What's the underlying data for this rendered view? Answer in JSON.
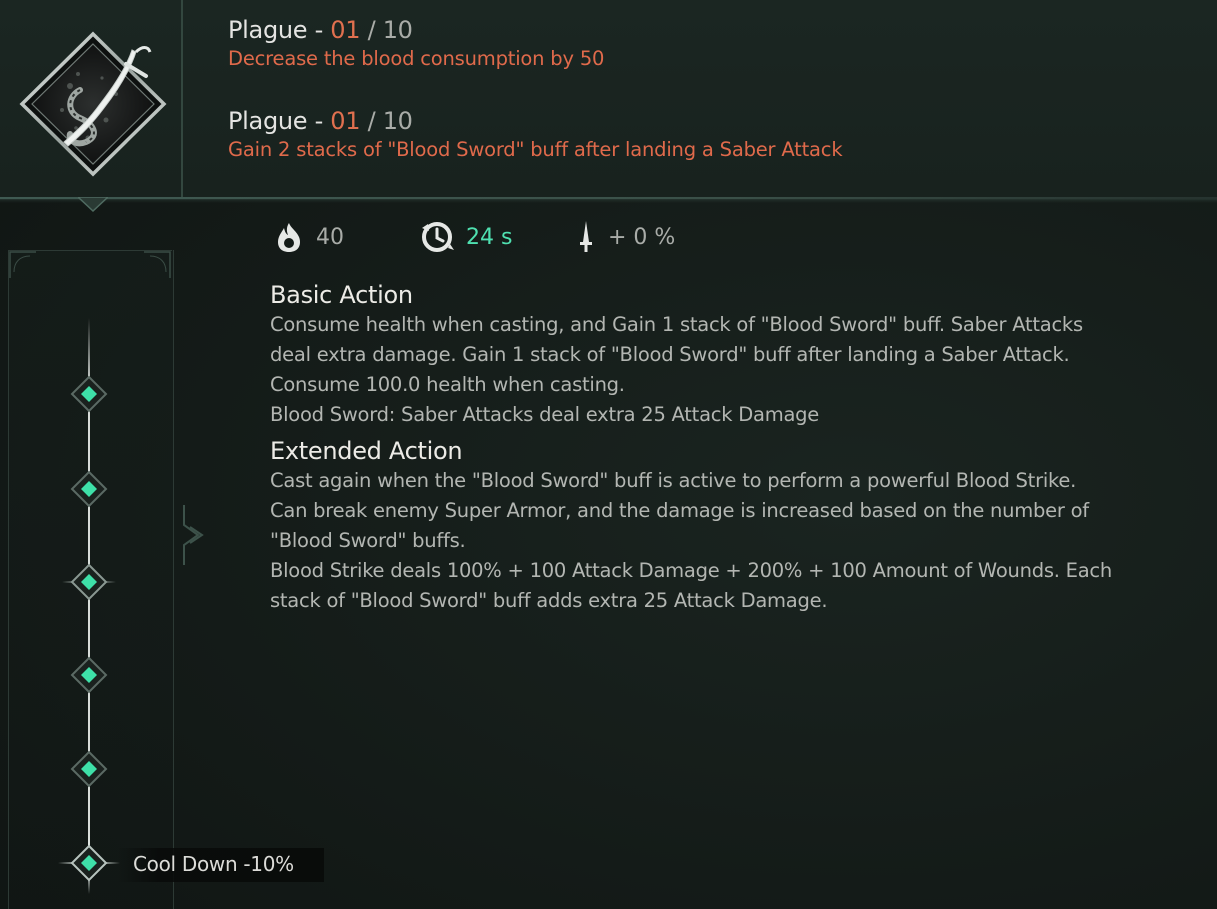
{
  "skill": {
    "icon": "saber-serpent-icon"
  },
  "plagues": [
    {
      "name": "Plague - ",
      "level": "01",
      "separator": " / ",
      "max": "10",
      "description": "Decrease the blood consumption by 50"
    },
    {
      "name": "Plague - ",
      "level": "01",
      "separator": " / ",
      "max": "10",
      "description": "Gain 2 stacks of \"Blood Sword\" buff after landing a Saber Attack"
    }
  ],
  "stats": {
    "blood_cost": {
      "icon": "blood-flame-icon",
      "value": "40"
    },
    "cooldown": {
      "icon": "cooldown-clock-icon",
      "value": "24 s"
    },
    "attack_bonus": {
      "icon": "dagger-icon",
      "value": "+ 0 %"
    }
  },
  "basic_action": {
    "title": "Basic Action",
    "lines": [
      "Consume health when casting, and Gain 1 stack of \"Blood Sword\" buff. Saber Attacks",
      "deal extra damage. Gain 1 stack of \"Blood Sword\" buff after landing a Saber Attack.",
      "Consume 100.0 health when casting.",
      "Blood Sword: Saber Attacks deal extra 25 Attack Damage"
    ]
  },
  "extended_action": {
    "title": "Extended Action",
    "lines": [
      "Cast again when the \"Blood Sword\" buff is active to perform a powerful Blood Strike.",
      "Can break enemy Super Armor, and the damage is increased based on the number of",
      "\"Blood Sword\" buffs.",
      "Blood Strike deals 100% + 100 Attack Damage + 200% + 100 Amount of Wounds. Each",
      "stack of \"Blood Sword\" buff adds extra 25 Attack Damage."
    ]
  },
  "track": {
    "nodes": [
      "node-1",
      "node-2",
      "node-3",
      "node-4",
      "node-5",
      "node-6"
    ],
    "active_node": "node-3",
    "selected_label": "Cool Down -10%"
  },
  "colors": {
    "accent_green": "#4fe0b0",
    "plague_red": "#e06a4b",
    "node_gem": "#3ee0a8"
  }
}
